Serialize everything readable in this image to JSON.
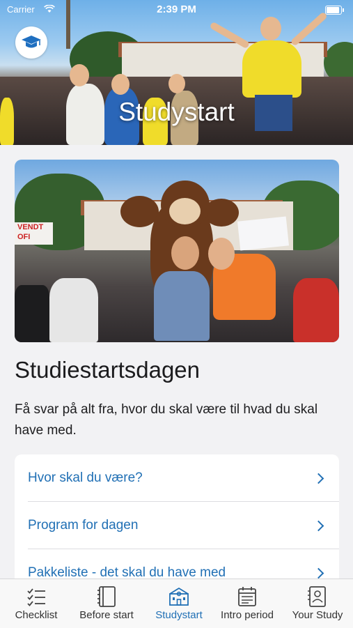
{
  "status_bar": {
    "carrier": "Carrier",
    "time": "2:39 PM",
    "battery_level": 0.95
  },
  "hero": {
    "title": "Studystart",
    "logo_icon": "graduation-cap-icon"
  },
  "content": {
    "section_title": "Studiestartsdagen",
    "intro_text": "Få svar på alt fra, hvor du skal være til hvad du skal have med.",
    "links": [
      {
        "label": "Hvor skal du være?"
      },
      {
        "label": "Program for dagen"
      },
      {
        "label": "Pakkeliste - det skal du have med"
      }
    ],
    "feature_sign": "VENDT OFI"
  },
  "tabbar": {
    "tabs": [
      {
        "label": "Checklist",
        "icon": "checklist-icon"
      },
      {
        "label": "Before start",
        "icon": "book-icon"
      },
      {
        "label": "Studystart",
        "icon": "building-icon",
        "active": true
      },
      {
        "label": "Intro period",
        "icon": "calendar-icon"
      },
      {
        "label": "Your Study",
        "icon": "id-card-icon"
      }
    ]
  },
  "colors": {
    "accent": "#2170b5",
    "background": "#f2f2f4",
    "card": "#ffffff"
  }
}
